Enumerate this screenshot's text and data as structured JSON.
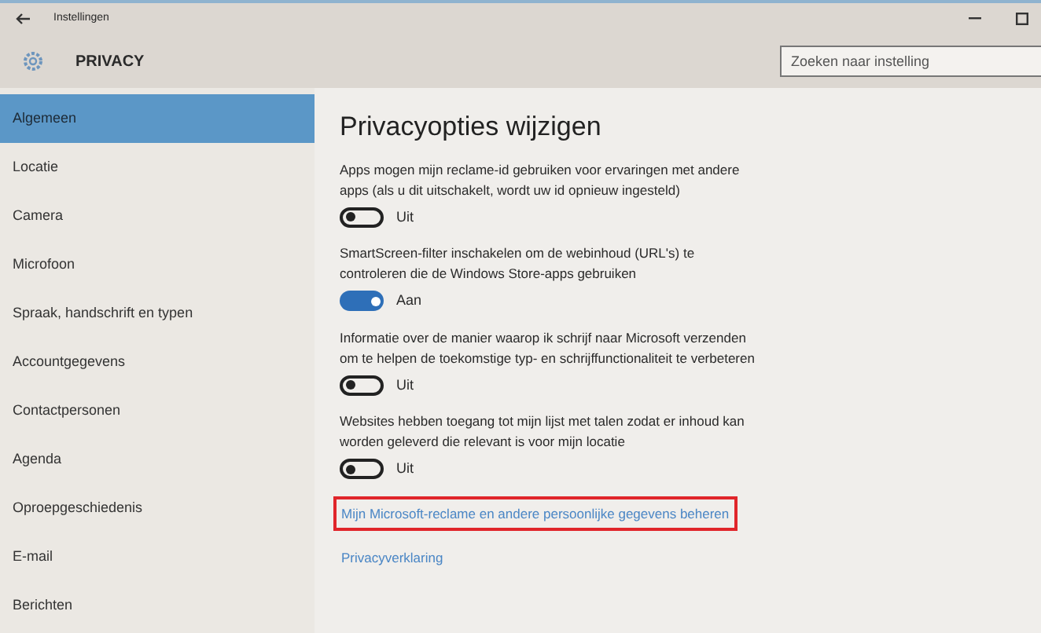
{
  "window": {
    "title": "Instellingen"
  },
  "header": {
    "title": "PRIVACY",
    "search": {
      "placeholder": "Zoeken naar instelling"
    }
  },
  "sidebar": {
    "items": [
      {
        "label": "Algemeen",
        "selected": true
      },
      {
        "label": "Locatie",
        "selected": false
      },
      {
        "label": "Camera",
        "selected": false
      },
      {
        "label": "Microfoon",
        "selected": false
      },
      {
        "label": "Spraak, handschrift en typen",
        "selected": false
      },
      {
        "label": "Accountgegevens",
        "selected": false
      },
      {
        "label": "Contactpersonen",
        "selected": false
      },
      {
        "label": "Agenda",
        "selected": false
      },
      {
        "label": "Oproepgeschiedenis",
        "selected": false
      },
      {
        "label": "E-mail",
        "selected": false
      },
      {
        "label": "Berichten",
        "selected": false
      }
    ]
  },
  "content": {
    "heading": "Privacyopties wijzigen",
    "options": [
      {
        "description": "Apps mogen mijn reclame-id gebruiken voor ervaringen met andere apps (als u dit uitschakelt, wordt uw id opnieuw ingesteld)",
        "on": false,
        "state_label": "Uit"
      },
      {
        "description": "SmartScreen-filter inschakelen om de webinhoud (URL's) te controleren die de Windows Store-apps gebruiken",
        "on": true,
        "state_label": "Aan"
      },
      {
        "description": "Informatie over de manier waarop ik schrijf naar Microsoft verzenden om te helpen de toekomstige typ- en schrijffunctionaliteit te verbeteren",
        "on": false,
        "state_label": "Uit"
      },
      {
        "description": "Websites hebben toegang tot mijn lijst met talen zodat er inhoud kan worden geleverd die relevant is voor mijn locatie",
        "on": false,
        "state_label": "Uit"
      }
    ],
    "links": [
      {
        "label": "Mijn Microsoft-reclame en andere persoonlijke gegevens beheren",
        "highlighted": true
      },
      {
        "label": "Privacyverklaring",
        "highlighted": false
      }
    ]
  }
}
